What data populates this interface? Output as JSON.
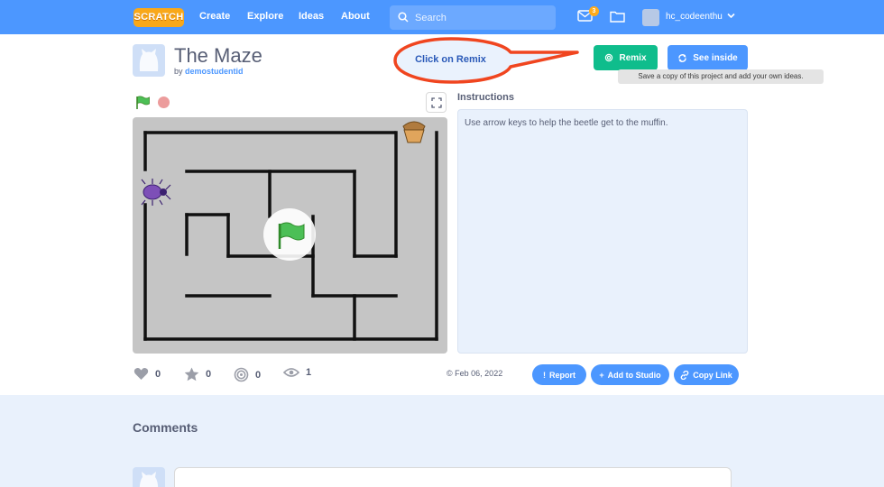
{
  "nav": {
    "logo": "SCRATCH",
    "links": [
      "Create",
      "Explore",
      "Ideas",
      "About"
    ],
    "search_placeholder": "Search",
    "messages_count": "3",
    "username": "hc_codeenthu"
  },
  "project": {
    "title": "The Maze",
    "by_label": "by",
    "author": "demostudentid",
    "callout": "Click on Remix",
    "remix_label": "Remix",
    "see_inside_label": "See inside",
    "tooltip": "Save a copy of this project and add your own ideas."
  },
  "instructions": {
    "title": "Instructions",
    "text": "Use arrow keys to help the beetle get to the muffin."
  },
  "stats": {
    "loves": "0",
    "favorites": "0",
    "remixes": "0",
    "views": "1",
    "date": "Feb 06, 2022",
    "report_label": "Report",
    "add_studio_label": "Add to Studio",
    "copy_link_label": "Copy Link"
  },
  "comments": {
    "title": "Comments"
  },
  "colors": {
    "nav": "#4c97ff",
    "remix": "#0fbd8c",
    "callout_border": "#f0451f",
    "stage": "#c5c5c5"
  }
}
